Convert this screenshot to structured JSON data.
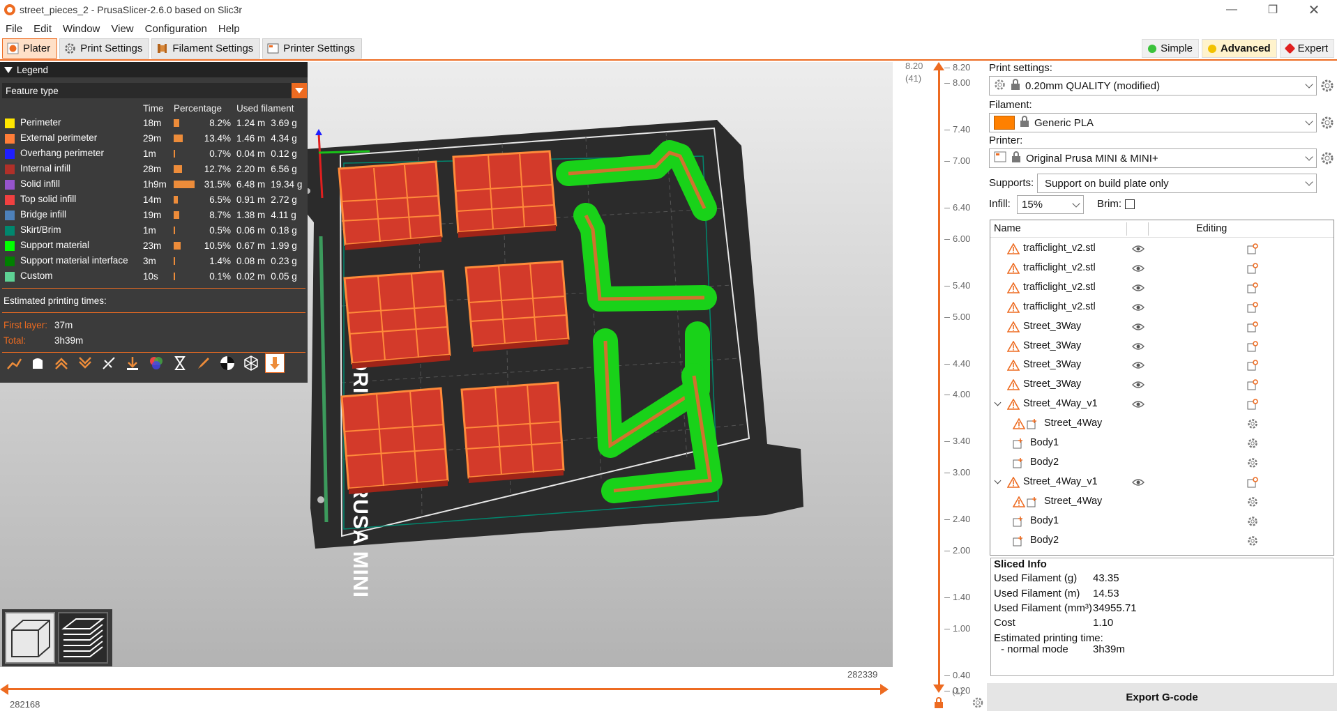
{
  "window": {
    "title": "street_pieces_2 - PrusaSlicer-2.6.0 based on Slic3r"
  },
  "menu": [
    "File",
    "Edit",
    "Window",
    "View",
    "Configuration",
    "Help"
  ],
  "tabs": [
    {
      "label": "Plater",
      "icon": "plater-icon"
    },
    {
      "label": "Print Settings",
      "icon": "cog-icon"
    },
    {
      "label": "Filament Settings",
      "icon": "spool-icon"
    },
    {
      "label": "Printer Settings",
      "icon": "printer-icon"
    }
  ],
  "modes": [
    {
      "label": "Simple",
      "color": "#3bc23b"
    },
    {
      "label": "Advanced",
      "color": "#f2c200"
    },
    {
      "label": "Expert",
      "color": "#e01f1f"
    }
  ],
  "legend": {
    "title": "Legend",
    "view_type": "Feature type",
    "columns": [
      "Time",
      "Percentage",
      "Used filament"
    ],
    "rows": [
      {
        "name": "Perimeter",
        "color": "#ffe600",
        "time": "18m",
        "pct": "8.2%",
        "pct_value": 8.2,
        "len": "1.24 m",
        "weight": "3.69 g"
      },
      {
        "name": "External perimeter",
        "color": "#ff7d38",
        "time": "29m",
        "pct": "13.4%",
        "pct_value": 13.4,
        "len": "1.46 m",
        "weight": "4.34 g"
      },
      {
        "name": "Overhang perimeter",
        "color": "#1f1fff",
        "time": "1m",
        "pct": "0.7%",
        "pct_value": 0.7,
        "len": "0.04 m",
        "weight": "0.12 g"
      },
      {
        "name": "Internal infill",
        "color": "#b03029",
        "time": "28m",
        "pct": "12.7%",
        "pct_value": 12.7,
        "len": "2.20 m",
        "weight": "6.56 g"
      },
      {
        "name": "Solid infill",
        "color": "#9654cc",
        "time": "1h9m",
        "pct": "31.5%",
        "pct_value": 31.5,
        "len": "6.48 m",
        "weight": "19.34 g"
      },
      {
        "name": "Top solid infill",
        "color": "#f04040",
        "time": "14m",
        "pct": "6.5%",
        "pct_value": 6.5,
        "len": "0.91 m",
        "weight": "2.72 g"
      },
      {
        "name": "Bridge infill",
        "color": "#4d80ba",
        "time": "19m",
        "pct": "8.7%",
        "pct_value": 8.7,
        "len": "1.38 m",
        "weight": "4.11 g"
      },
      {
        "name": "Skirt/Brim",
        "color": "#00876e",
        "time": "1m",
        "pct": "0.5%",
        "pct_value": 0.5,
        "len": "0.06 m",
        "weight": "0.18 g"
      },
      {
        "name": "Support material",
        "color": "#00ff00",
        "time": "23m",
        "pct": "10.5%",
        "pct_value": 10.5,
        "len": "0.67 m",
        "weight": "1.99 g"
      },
      {
        "name": "Support material interface",
        "color": "#008000",
        "time": "3m",
        "pct": "1.4%",
        "pct_value": 1.4,
        "len": "0.08 m",
        "weight": "0.23 g"
      },
      {
        "name": "Custom",
        "color": "#5ed194",
        "time": "10s",
        "pct": "0.1%",
        "pct_value": 0.1,
        "len": "0.02 m",
        "weight": "0.05 g"
      }
    ],
    "estimated_label": "Estimated printing times:",
    "first_layer_label": "First layer:",
    "first_layer": "37m",
    "total_label": "Total:",
    "total": "3h39m"
  },
  "bed_label": "ORIGINAL PRUSA MINI",
  "hslider": {
    "top_value": "282339",
    "bottom_value": "282168"
  },
  "vslider": {
    "top_height": "8.20",
    "top_layer": "(41)",
    "bottom_layer": "(1)",
    "ticks": [
      "8.20",
      "8.00",
      "7.40",
      "7.00",
      "6.40",
      "6.00",
      "5.40",
      "5.00",
      "4.40",
      "4.00",
      "3.40",
      "3.00",
      "2.40",
      "2.00",
      "1.40",
      "1.00",
      "0.40",
      "0.20"
    ]
  },
  "panel": {
    "print_settings_label": "Print settings:",
    "print_settings_value": "0.20mm QUALITY (modified)",
    "filament_label": "Filament:",
    "filament_value": "Generic PLA",
    "filament_color": "#ff8000",
    "printer_label": "Printer:",
    "printer_value": "Original Prusa MINI & MINI+",
    "supports_label": "Supports:",
    "supports_value": "Support on build plate only",
    "infill_label": "Infill:",
    "infill_value": "15%",
    "brim_label": "Brim:"
  },
  "objects": {
    "name_header": "Name",
    "editing_header": "Editing",
    "rows": [
      {
        "name": "trafficlight_v2.stl",
        "level": 0,
        "warn": true,
        "eye": true,
        "expand": false,
        "part": false
      },
      {
        "name": "trafficlight_v2.stl",
        "level": 0,
        "warn": true,
        "eye": true,
        "expand": false,
        "part": false
      },
      {
        "name": "trafficlight_v2.stl",
        "level": 0,
        "warn": true,
        "eye": true,
        "expand": false,
        "part": false
      },
      {
        "name": "trafficlight_v2.stl",
        "level": 0,
        "warn": true,
        "eye": true,
        "expand": false,
        "part": false
      },
      {
        "name": "Street_3Way",
        "level": 0,
        "warn": true,
        "eye": true,
        "expand": false,
        "part": false
      },
      {
        "name": "Street_3Way",
        "level": 0,
        "warn": true,
        "eye": true,
        "expand": false,
        "part": false
      },
      {
        "name": "Street_3Way",
        "level": 0,
        "warn": true,
        "eye": true,
        "expand": false,
        "part": false
      },
      {
        "name": "Street_3Way",
        "level": 0,
        "warn": true,
        "eye": true,
        "expand": false,
        "part": false
      },
      {
        "name": "Street_4Way_v1",
        "level": 0,
        "warn": true,
        "eye": true,
        "expand": true,
        "part": false
      },
      {
        "name": "Street_4Way",
        "level": 1,
        "warn": true,
        "eye": false,
        "expand": false,
        "part": true
      },
      {
        "name": "Body1",
        "level": 1,
        "warn": false,
        "eye": false,
        "expand": false,
        "part": true
      },
      {
        "name": "Body2",
        "level": 1,
        "warn": false,
        "eye": false,
        "expand": false,
        "part": true
      },
      {
        "name": "Street_4Way_v1",
        "level": 0,
        "warn": true,
        "eye": true,
        "expand": true,
        "part": false
      },
      {
        "name": "Street_4Way",
        "level": 1,
        "warn": true,
        "eye": false,
        "expand": false,
        "part": true
      },
      {
        "name": "Body1",
        "level": 1,
        "warn": false,
        "eye": false,
        "expand": false,
        "part": true
      },
      {
        "name": "Body2",
        "level": 1,
        "warn": false,
        "eye": false,
        "expand": false,
        "part": true
      }
    ]
  },
  "sliced_info": {
    "title": "Sliced Info",
    "rows": [
      {
        "label": "Used Filament (g)",
        "value": "43.35"
      },
      {
        "label": "Used Filament (m)",
        "value": "14.53"
      },
      {
        "label": "Used Filament (mm³)",
        "value": "34955.71"
      },
      {
        "label": "Cost",
        "value": "1.10"
      }
    ],
    "time_label": "Estimated printing time:",
    "normal_mode_label": "- normal mode",
    "normal_mode_value": "3h39m"
  },
  "export_button": "Export G-code"
}
